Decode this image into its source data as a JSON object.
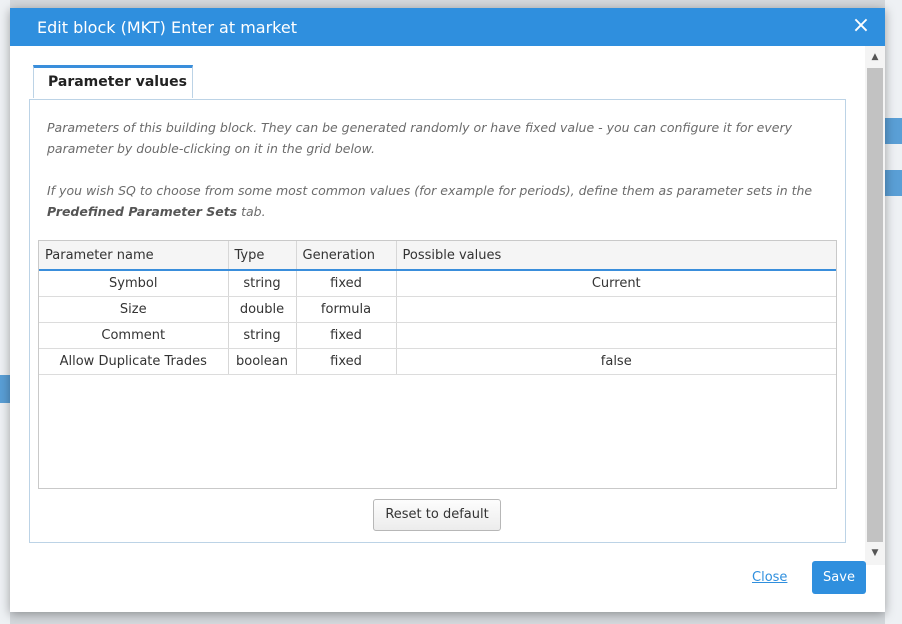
{
  "dialog": {
    "title": "Edit block (MKT) Enter at market",
    "close_icon": "×"
  },
  "tab": {
    "label": "Parameter values"
  },
  "description": {
    "line1": "Parameters of this building block. They can be generated randomly or have fixed value - you can configure it for every parameter by double-clicking on it in the grid below.",
    "line2_pre": "If you wish SQ to choose from some most common values (for example for periods), define them as parameter sets in the ",
    "line2_bold": "Predefined Parameter Sets",
    "line2_post": " tab."
  },
  "grid": {
    "columns": [
      "Parameter name",
      "Type",
      "Generation",
      "Possible values"
    ],
    "rows": [
      {
        "name": "Symbol",
        "type": "string",
        "generation": "fixed",
        "values": "Current"
      },
      {
        "name": "Size",
        "type": "double",
        "generation": "formula",
        "values": ""
      },
      {
        "name": "Comment",
        "type": "string",
        "generation": "fixed",
        "values": ""
      },
      {
        "name": "Allow Duplicate Trades",
        "type": "boolean",
        "generation": "fixed",
        "values": "false"
      }
    ]
  },
  "buttons": {
    "reset": "Reset to default",
    "close": "Close",
    "save": "Save"
  },
  "colors": {
    "accent": "#2f8fde",
    "title_text": "#ffffff"
  }
}
